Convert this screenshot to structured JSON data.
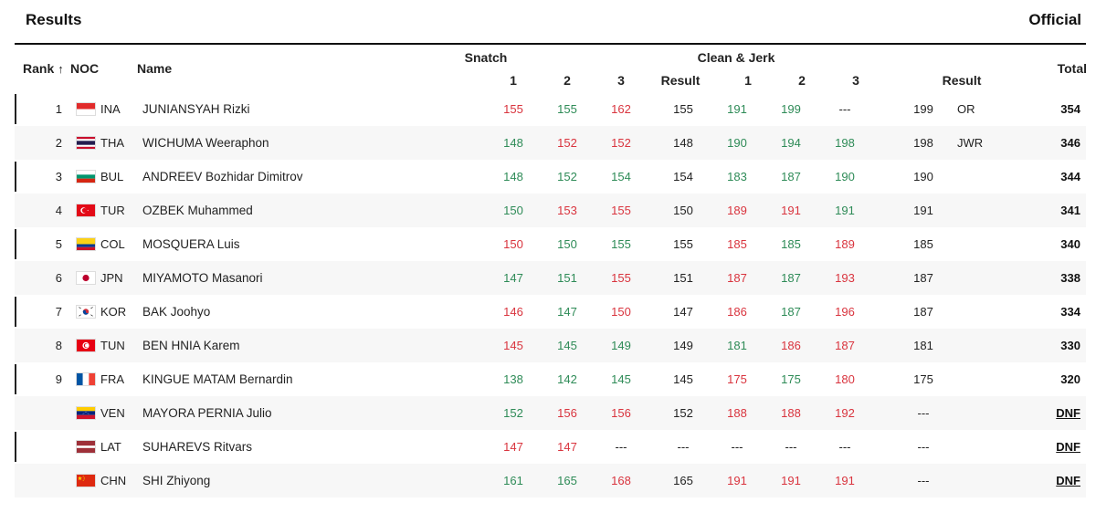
{
  "page": {
    "title": "Results",
    "status": "Official"
  },
  "headers": {
    "rank": "Rank",
    "sort_arrow": "↑",
    "noc": "NOC",
    "name": "Name",
    "snatch": "Snatch",
    "clean_jerk": "Clean & Jerk",
    "attempt1": "1",
    "attempt2": "2",
    "attempt3": "3",
    "result": "Result",
    "total": "Total"
  },
  "colors": {
    "good_lift": "#2e8b57",
    "no_lift": "#d9343e"
  },
  "athletes": [
    {
      "rank": "1",
      "noc": "INA",
      "flag": "flag-indonesia-icon",
      "name": "JUNIANSYAH Rizki",
      "snatch": [
        {
          "v": "155",
          "s": "bad"
        },
        {
          "v": "155",
          "s": "good"
        },
        {
          "v": "162",
          "s": "bad"
        }
      ],
      "snatch_result": "155",
      "cj": [
        {
          "v": "191",
          "s": "good"
        },
        {
          "v": "199",
          "s": "good"
        },
        {
          "v": "---",
          "s": "dash"
        }
      ],
      "cj_result": "199",
      "record": "OR",
      "total": "354"
    },
    {
      "rank": "2",
      "noc": "THA",
      "flag": "flag-thailand-icon",
      "name": "WICHUMA Weeraphon",
      "snatch": [
        {
          "v": "148",
          "s": "good"
        },
        {
          "v": "152",
          "s": "bad"
        },
        {
          "v": "152",
          "s": "bad"
        }
      ],
      "snatch_result": "148",
      "cj": [
        {
          "v": "190",
          "s": "good"
        },
        {
          "v": "194",
          "s": "good"
        },
        {
          "v": "198",
          "s": "good"
        }
      ],
      "cj_result": "198",
      "record": "JWR",
      "total": "346"
    },
    {
      "rank": "3",
      "noc": "BUL",
      "flag": "flag-bulgaria-icon",
      "name": "ANDREEV Bozhidar Dimitrov",
      "snatch": [
        {
          "v": "148",
          "s": "good"
        },
        {
          "v": "152",
          "s": "good"
        },
        {
          "v": "154",
          "s": "good"
        }
      ],
      "snatch_result": "154",
      "cj": [
        {
          "v": "183",
          "s": "good"
        },
        {
          "v": "187",
          "s": "good"
        },
        {
          "v": "190",
          "s": "good"
        }
      ],
      "cj_result": "190",
      "record": "",
      "total": "344"
    },
    {
      "rank": "4",
      "noc": "TUR",
      "flag": "flag-turkey-icon",
      "name": "OZBEK Muhammed",
      "snatch": [
        {
          "v": "150",
          "s": "good"
        },
        {
          "v": "153",
          "s": "bad"
        },
        {
          "v": "155",
          "s": "bad"
        }
      ],
      "snatch_result": "150",
      "cj": [
        {
          "v": "189",
          "s": "bad"
        },
        {
          "v": "191",
          "s": "bad"
        },
        {
          "v": "191",
          "s": "good"
        }
      ],
      "cj_result": "191",
      "record": "",
      "total": "341"
    },
    {
      "rank": "5",
      "noc": "COL",
      "flag": "flag-colombia-icon",
      "name": "MOSQUERA Luis",
      "snatch": [
        {
          "v": "150",
          "s": "bad"
        },
        {
          "v": "150",
          "s": "good"
        },
        {
          "v": "155",
          "s": "good"
        }
      ],
      "snatch_result": "155",
      "cj": [
        {
          "v": "185",
          "s": "bad"
        },
        {
          "v": "185",
          "s": "good"
        },
        {
          "v": "189",
          "s": "bad"
        }
      ],
      "cj_result": "185",
      "record": "",
      "total": "340"
    },
    {
      "rank": "6",
      "noc": "JPN",
      "flag": "flag-japan-icon",
      "name": "MIYAMOTO Masanori",
      "snatch": [
        {
          "v": "147",
          "s": "good"
        },
        {
          "v": "151",
          "s": "good"
        },
        {
          "v": "155",
          "s": "bad"
        }
      ],
      "snatch_result": "151",
      "cj": [
        {
          "v": "187",
          "s": "bad"
        },
        {
          "v": "187",
          "s": "good"
        },
        {
          "v": "193",
          "s": "bad"
        }
      ],
      "cj_result": "187",
      "record": "",
      "total": "338"
    },
    {
      "rank": "7",
      "noc": "KOR",
      "flag": "flag-korea-icon",
      "name": "BAK Joohyo",
      "snatch": [
        {
          "v": "146",
          "s": "bad"
        },
        {
          "v": "147",
          "s": "good"
        },
        {
          "v": "150",
          "s": "bad"
        }
      ],
      "snatch_result": "147",
      "cj": [
        {
          "v": "186",
          "s": "bad"
        },
        {
          "v": "187",
          "s": "good"
        },
        {
          "v": "196",
          "s": "bad"
        }
      ],
      "cj_result": "187",
      "record": "",
      "total": "334"
    },
    {
      "rank": "8",
      "noc": "TUN",
      "flag": "flag-tunisia-icon",
      "name": "BEN HNIA Karem",
      "snatch": [
        {
          "v": "145",
          "s": "bad"
        },
        {
          "v": "145",
          "s": "good"
        },
        {
          "v": "149",
          "s": "good"
        }
      ],
      "snatch_result": "149",
      "cj": [
        {
          "v": "181",
          "s": "good"
        },
        {
          "v": "186",
          "s": "bad"
        },
        {
          "v": "187",
          "s": "bad"
        }
      ],
      "cj_result": "181",
      "record": "",
      "total": "330"
    },
    {
      "rank": "9",
      "noc": "FRA",
      "flag": "flag-france-icon",
      "name": "KINGUE MATAM Bernardin",
      "snatch": [
        {
          "v": "138",
          "s": "good"
        },
        {
          "v": "142",
          "s": "good"
        },
        {
          "v": "145",
          "s": "good"
        }
      ],
      "snatch_result": "145",
      "cj": [
        {
          "v": "175",
          "s": "bad"
        },
        {
          "v": "175",
          "s": "good"
        },
        {
          "v": "180",
          "s": "bad"
        }
      ],
      "cj_result": "175",
      "record": "",
      "total": "320"
    },
    {
      "rank": "",
      "noc": "VEN",
      "flag": "flag-venezuela-icon",
      "name": "MAYORA PERNIA Julio",
      "snatch": [
        {
          "v": "152",
          "s": "good"
        },
        {
          "v": "156",
          "s": "bad"
        },
        {
          "v": "156",
          "s": "bad"
        }
      ],
      "snatch_result": "152",
      "cj": [
        {
          "v": "188",
          "s": "bad"
        },
        {
          "v": "188",
          "s": "bad"
        },
        {
          "v": "192",
          "s": "bad"
        }
      ],
      "cj_result": "---",
      "record": "",
      "total": "DNF"
    },
    {
      "rank": "",
      "noc": "LAT",
      "flag": "flag-latvia-icon",
      "name": "SUHAREVS Ritvars",
      "snatch": [
        {
          "v": "147",
          "s": "bad"
        },
        {
          "v": "147",
          "s": "bad"
        },
        {
          "v": "---",
          "s": "dash"
        }
      ],
      "snatch_result": "---",
      "cj": [
        {
          "v": "---",
          "s": "dash"
        },
        {
          "v": "---",
          "s": "dash"
        },
        {
          "v": "---",
          "s": "dash"
        }
      ],
      "cj_result": "---",
      "record": "",
      "total": "DNF"
    },
    {
      "rank": "",
      "noc": "CHN",
      "flag": "flag-china-icon",
      "name": "SHI Zhiyong",
      "snatch": [
        {
          "v": "161",
          "s": "good"
        },
        {
          "v": "165",
          "s": "good"
        },
        {
          "v": "168",
          "s": "bad"
        }
      ],
      "snatch_result": "165",
      "cj": [
        {
          "v": "191",
          "s": "bad"
        },
        {
          "v": "191",
          "s": "bad"
        },
        {
          "v": "191",
          "s": "bad"
        }
      ],
      "cj_result": "---",
      "record": "",
      "total": "DNF"
    }
  ]
}
